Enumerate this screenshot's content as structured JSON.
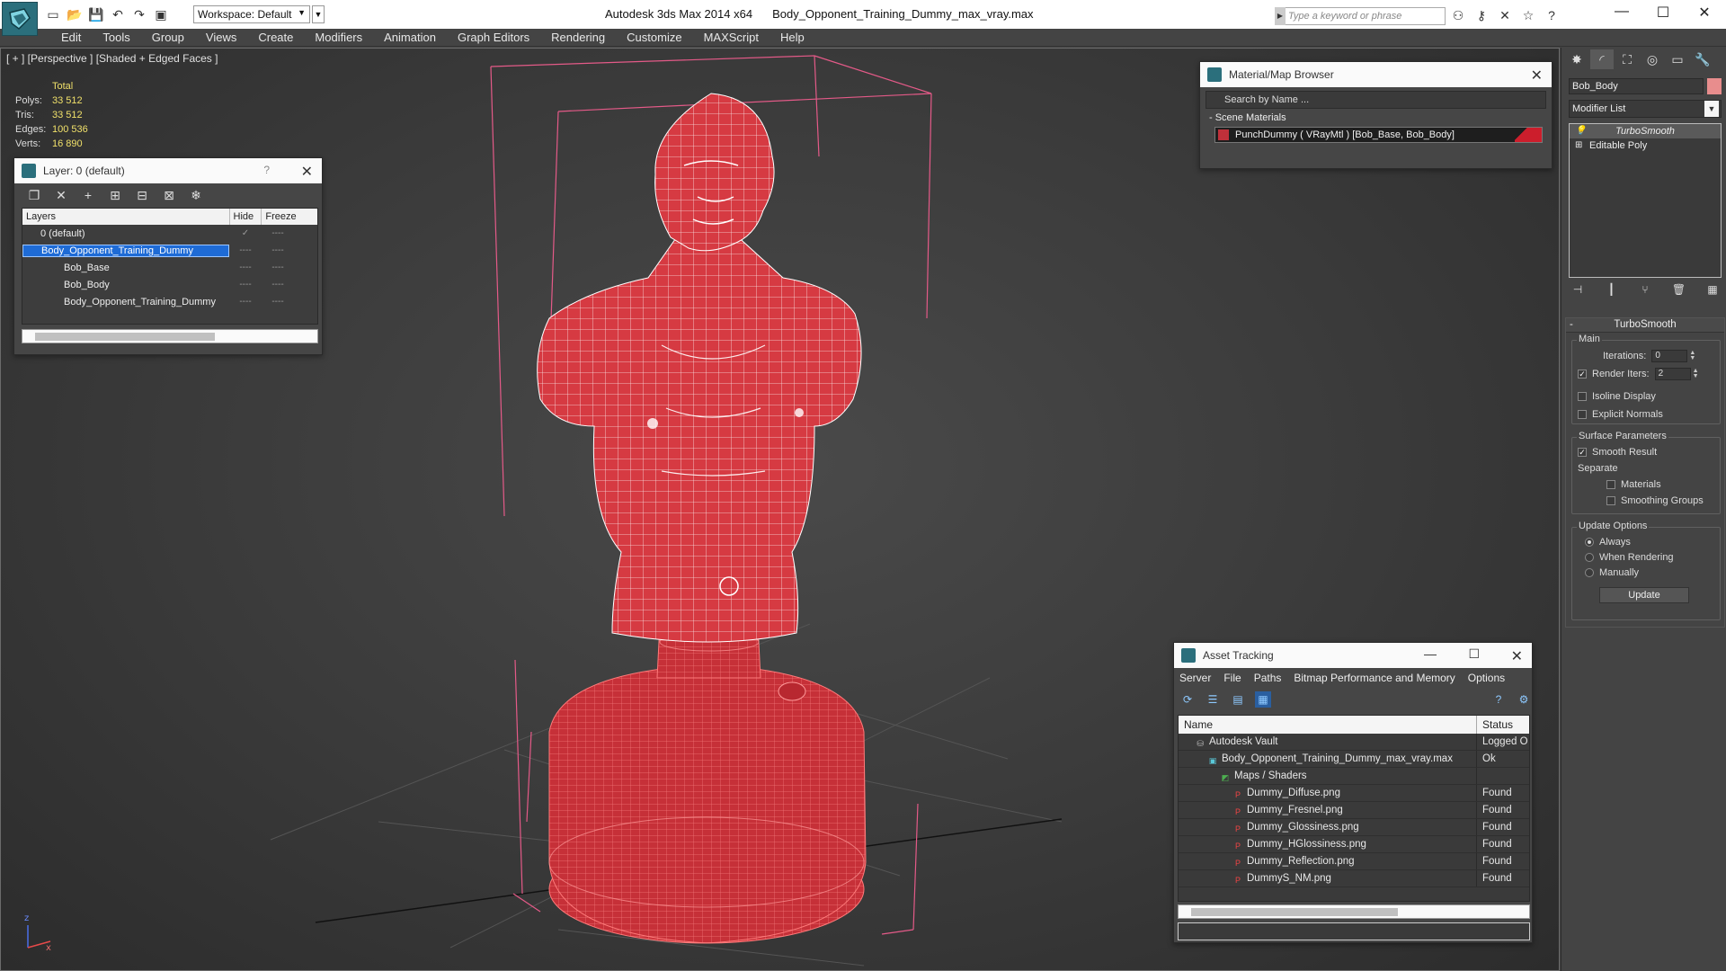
{
  "titlebar": {
    "app_name": "Autodesk 3ds Max  2014 x64",
    "file_name": "Body_Opponent_Training_Dummy_max_vray.max",
    "workspace": "Workspace: Default",
    "search_placeholder": "Type a keyword or phrase",
    "minimize": "—",
    "maximize": "☐",
    "close": "✕"
  },
  "menu": [
    "Edit",
    "Tools",
    "Group",
    "Views",
    "Create",
    "Modifiers",
    "Animation",
    "Graph Editors",
    "Rendering",
    "Customize",
    "MAXScript",
    "Help"
  ],
  "viewport": {
    "label": "[ + ] [Perspective ] [Shaded + Edged Faces ]",
    "stats_header": "Total",
    "stats": [
      {
        "key": "Polys:",
        "value": "33 512"
      },
      {
        "key": "Tris:",
        "value": "33 512"
      },
      {
        "key": "Edges:",
        "value": "100 536"
      },
      {
        "key": "Verts:",
        "value": "16 890"
      }
    ],
    "axis_labels": {
      "z": "z",
      "x": "x"
    },
    "mesh_color": "#d63a42",
    "wire_color": "#ffffff"
  },
  "layer_panel": {
    "title": "Layer: 0 (default)",
    "help": "?",
    "close": "✕",
    "columns": [
      "Layers",
      "Hide",
      "Freeze"
    ],
    "rows": [
      {
        "name": "0 (default)",
        "check": "✓"
      },
      {
        "name": "Body_Opponent_Training_Dummy"
      },
      {
        "name": "Bob_Base"
      },
      {
        "name": "Bob_Body"
      },
      {
        "name": "Body_Opponent_Training_Dummy"
      }
    ],
    "dash": "----"
  },
  "material_browser": {
    "title": "Material/Map Browser",
    "search": "Search by Name ...",
    "section": "- Scene Materials",
    "item": "PunchDummy  ( VRayMtl ) [Bob_Base, Bob_Body]"
  },
  "asset_tracking": {
    "title": "Asset Tracking",
    "menu": [
      "Server",
      "File",
      "Paths",
      "Bitmap Performance and Memory",
      "Options"
    ],
    "columns": [
      "Name",
      "Status"
    ],
    "rows": [
      {
        "name": "Autodesk Vault",
        "status": "Logged O",
        "indent": 1,
        "icon": "vault"
      },
      {
        "name": "Body_Opponent_Training_Dummy_max_vray.max",
        "status": "Ok",
        "indent": 2,
        "icon": "max"
      },
      {
        "name": "Maps / Shaders",
        "status": "",
        "indent": 3,
        "icon": "maps"
      },
      {
        "name": "Dummy_Diffuse.png",
        "status": "Found",
        "indent": 4,
        "icon": "png"
      },
      {
        "name": "Dummy_Fresnel.png",
        "status": "Found",
        "indent": 4,
        "icon": "png"
      },
      {
        "name": "Dummy_Glossiness.png",
        "status": "Found",
        "indent": 4,
        "icon": "png"
      },
      {
        "name": "Dummy_HGlossiness.png",
        "status": "Found",
        "indent": 4,
        "icon": "png"
      },
      {
        "name": "Dummy_Reflection.png",
        "status": "Found",
        "indent": 4,
        "icon": "png"
      },
      {
        "name": "DummyS_NM.png",
        "status": "Found",
        "indent": 4,
        "icon": "png"
      }
    ]
  },
  "command_panel": {
    "object_name": "Bob_Body",
    "object_color": "#e88d8d",
    "modifier_list": "Modifier List",
    "stack": [
      "TurboSmooth",
      "Editable Poly"
    ],
    "rollout_title": "TurboSmooth",
    "main_group": "Main",
    "iterations_label": "Iterations:",
    "iterations_value": "0",
    "render_iters_label": "Render Iters:",
    "render_iters_value": "2",
    "isoline": "Isoline Display",
    "explicit_normals": "Explicit Normals",
    "surface_group": "Surface Parameters",
    "smooth_result": "Smooth Result",
    "separate": "Separate",
    "materials": "Materials",
    "smoothing_groups": "Smoothing Groups",
    "update_group": "Update Options",
    "always": "Always",
    "when_rendering": "When Rendering",
    "manually": "Manually",
    "update_button": "Update"
  }
}
